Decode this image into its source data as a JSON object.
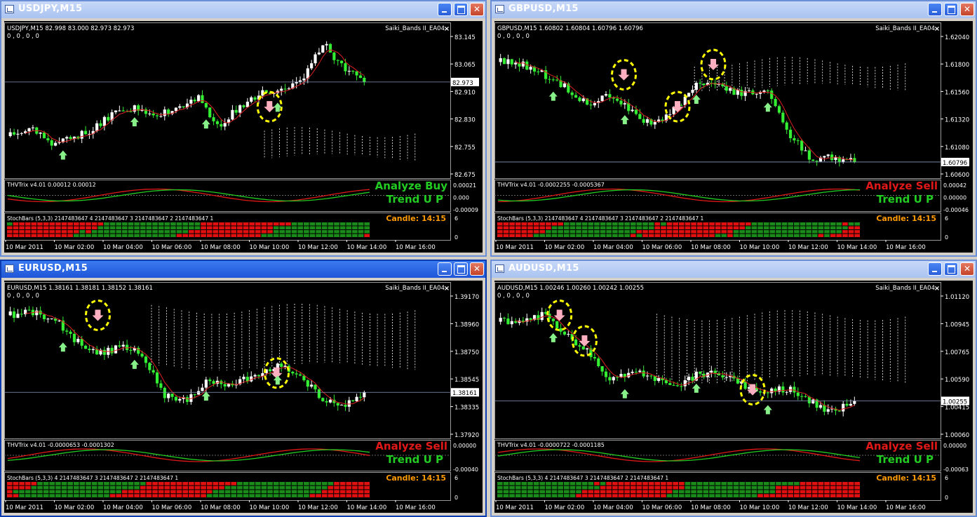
{
  "windows": [
    {
      "id": "usdjpy",
      "title": "USDJPY,M15",
      "active": false,
      "symbol_line": "USDJPY,M15  82.998 83.000 82.973 82.973",
      "sub_line": "0 , 0 , 0 , 0",
      "ea_label": "Saiki_Bands II_EA04",
      "prices": [
        "83.145",
        "83.065",
        "82.910",
        "82.830",
        "82.755",
        "82.675"
      ],
      "current_price": "82.973",
      "trix_label": "THVTrix v4.01  0.00012  0.00012",
      "trix_scale": [
        "0.00021",
        "0.000",
        "-0.00009"
      ],
      "signal": "Analyze Buy",
      "signal_color": "#22cc22",
      "trend": "Trend U P",
      "stoch_label": "StochBars (5,3,3)  2147483647  4  2147483647  3  2147483647  2  2147483647  1",
      "candle": "Candle:  14:15",
      "stoch_scale": [
        "6",
        "0"
      ],
      "times": [
        "10 Mar 2011",
        "10 Mar 02:00",
        "10 Mar 04:00",
        "10 Mar 06:00",
        "10 Mar 08:00",
        "10 Mar 10:00",
        "10 Mar 12:00",
        "10 Mar 14:00",
        "10 Mar 16:00"
      ]
    },
    {
      "id": "gbpusd",
      "title": "GBPUSD,M15",
      "active": false,
      "symbol_line": "GBPUSD,M15  1.60802  1.60804  1.60796  1.60796",
      "sub_line": "0 , 0 , 0 , 0",
      "ea_label": "Saiki_Bands II_EA04",
      "prices": [
        "1.62040",
        "1.61800",
        "1.61560",
        "1.61320",
        "1.61080",
        "1.60600"
      ],
      "current_price": "1.60796",
      "trix_label": "THVTrix v4.01  -0.0002255  -0.0005367",
      "trix_scale": [
        "0.00042",
        "0.00000",
        "-0.00046"
      ],
      "signal": "Analyze Sell",
      "signal_color": "#e01818",
      "trend": "Trend U P",
      "stoch_label": "StochBars (5,3,3)  2147483647  4  2147483647  3  2147483647  2  2147483647  1",
      "candle": "Candle:  14:15",
      "stoch_scale": [
        "6",
        "0"
      ],
      "times": [
        "10 Mar 2011",
        "10 Mar 02:00",
        "10 Mar 04:00",
        "10 Mar 06:00",
        "10 Mar 08:00",
        "10 Mar 10:00",
        "10 Mar 12:00",
        "10 Mar 14:00",
        "10 Mar 16:00"
      ]
    },
    {
      "id": "eurusd",
      "title": "EURUSD,M15",
      "active": true,
      "symbol_line": "EURUSD,M15  1.38161  1.38181  1.38152  1.38161",
      "sub_line": "0 , 0 , 0 , 0",
      "ea_label": "Saiki_Bands II_EA04",
      "prices": [
        "1.39170",
        "1.38960",
        "1.38750",
        "1.38545",
        "1.38335",
        "1.37920"
      ],
      "current_price": "1.38161",
      "trix_label": "THVTrix v4.01  -0.0000653  -0.0001302",
      "trix_scale": [
        "0.00000",
        "-0.00040"
      ],
      "signal": "Analyze Sell",
      "signal_color": "#e01818",
      "trend": "Trend U P",
      "stoch_label": "StochBars (5,3,3)  4  2147483647  3  2147483647  2  2147483647  1",
      "candle": "Candle:  14:15",
      "stoch_scale": [
        "6",
        "0"
      ],
      "times": [
        "10 Mar 2011",
        "10 Mar 02:00",
        "10 Mar 04:00",
        "10 Mar 06:00",
        "10 Mar 08:00",
        "10 Mar 10:00",
        "10 Mar 12:00",
        "10 Mar 14:00",
        "10 Mar 16:00"
      ]
    },
    {
      "id": "audusd",
      "title": "AUDUSD,M15",
      "active": false,
      "symbol_line": "AUDUSD,M15  1.00246  1.00260  1.00242  1.00255",
      "sub_line": "0 , 0 , 0 , 0",
      "ea_label": "Saiki_Bands II_EA04",
      "prices": [
        "1.01120",
        "1.00945",
        "1.00765",
        "1.00590",
        "1.00415",
        "1.00060"
      ],
      "current_price": "1.00255",
      "trix_label": "THVTrix v4.01  -0.0000722  -0.0001185",
      "trix_scale": [
        "0.00000",
        "-0.00063"
      ],
      "signal": "Analyze Sell",
      "signal_color": "#e01818",
      "trend": "Trend U P",
      "stoch_label": "StochBars (5,3,3)  4  2147483647  3  2147483647  2  2147483647  1",
      "candle": "Candle:  14:15",
      "stoch_scale": [
        "6",
        "0"
      ],
      "times": [
        "10 Mar 2011",
        "10 Mar 02:00",
        "10 Mar 04:00",
        "10 Mar 06:00",
        "10 Mar 08:00",
        "10 Mar 10:00",
        "10 Mar 12:00",
        "10 Mar 14:00",
        "10 Mar 16:00"
      ]
    }
  ],
  "colors": {
    "bull_candle": "#ffffff",
    "bear_candle": "#33ee33",
    "ma_line": "#dd2020",
    "trix_green": "#22cc22",
    "trix_red": "#e01818",
    "stoch_green": "#1a8a1a",
    "stoch_red": "#e01010",
    "candle_text": "#ff9a00",
    "highlight": "#ffff00",
    "buy_arrow": "#88f088",
    "sell_arrow": "#ffb0c0"
  },
  "icons": {
    "window": "chart-window-icon",
    "minimize": "minimize-icon",
    "maximize": "maximize-icon",
    "close": "close-icon"
  }
}
